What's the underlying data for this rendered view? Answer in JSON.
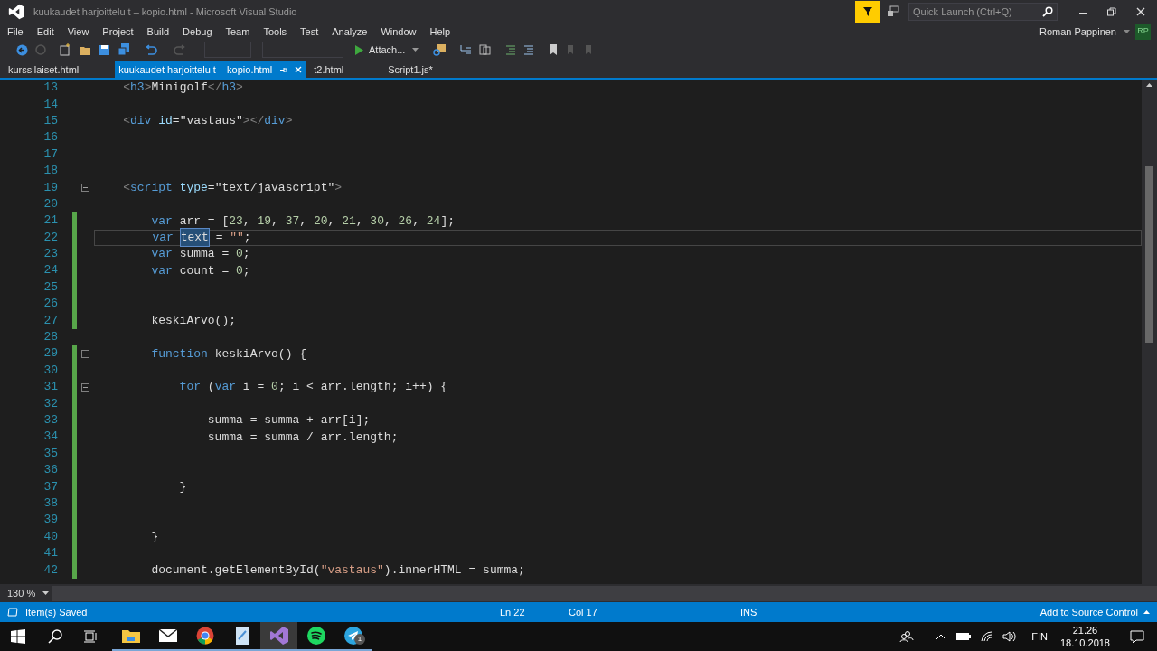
{
  "window": {
    "title": "kuukaudet harjoittelu t – kopio.html - Microsoft Visual Studio",
    "quick_launch": {
      "placeholder": "Quick Launch (Ctrl+Q)"
    },
    "user": "Roman Pappinen",
    "avatar": "RP"
  },
  "menu": [
    "File",
    "Edit",
    "View",
    "Project",
    "Build",
    "Debug",
    "Team",
    "Tools",
    "Test",
    "Analyze",
    "Window",
    "Help"
  ],
  "toolbar": {
    "attach": "Attach..."
  },
  "tabs": [
    {
      "label": "kurssilaiset.html",
      "selected": false
    },
    {
      "label": "kuukaudet harjoittelu t – kopio.html",
      "selected": true
    },
    {
      "label": "t2.html",
      "selected": false
    },
    {
      "label": "Script1.js*",
      "selected": false
    }
  ],
  "editor": {
    "lines": [
      {
        "n": "13",
        "modified": false,
        "fold": false,
        "current": false,
        "tokens": [
          {
            "t": "    <",
            "kind": "punct"
          },
          {
            "t": "h3",
            "kind": "tag"
          },
          {
            "t": ">",
            "kind": "punct"
          },
          {
            "t": "Minigolf",
            "kind": "plain"
          },
          {
            "t": "</",
            "kind": "punct"
          },
          {
            "t": "h3",
            "kind": "tag"
          },
          {
            "t": ">",
            "kind": "punct"
          }
        ]
      },
      {
        "n": "14",
        "modified": false,
        "fold": false,
        "current": false
      },
      {
        "n": "15",
        "modified": false,
        "fold": false,
        "current": false,
        "tokens": [
          {
            "t": "    <",
            "kind": "punct"
          },
          {
            "t": "div",
            "kind": "tag"
          },
          {
            "t": " id",
            "kind": "attr"
          },
          {
            "t": "=\"vastaus\"",
            "kind": "plain"
          },
          {
            "t": "></",
            "kind": "punct"
          },
          {
            "t": "div",
            "kind": "tag"
          },
          {
            "t": ">",
            "kind": "punct"
          }
        ]
      },
      {
        "n": "16",
        "modified": false,
        "fold": false,
        "current": false
      },
      {
        "n": "17",
        "modified": false,
        "fold": false,
        "current": false
      },
      {
        "n": "18",
        "modified": false,
        "fold": false,
        "current": false
      },
      {
        "n": "19",
        "modified": false,
        "fold": true,
        "current": false,
        "tokens": [
          {
            "t": "    <",
            "kind": "punct"
          },
          {
            "t": "script",
            "kind": "tag"
          },
          {
            "t": " type",
            "kind": "attr"
          },
          {
            "t": "=\"text/javascript\"",
            "kind": "plain"
          },
          {
            "t": ">",
            "kind": "punct"
          }
        ]
      },
      {
        "n": "20",
        "modified": false,
        "fold": false,
        "current": false
      },
      {
        "n": "21",
        "modified": true,
        "fold": false,
        "current": false,
        "tokens": [
          {
            "t": "        var",
            "kind": "kw"
          },
          {
            "t": " arr = [",
            "kind": "plain"
          },
          {
            "t": "23",
            "kind": "num"
          },
          {
            "t": ", ",
            "kind": "plain"
          },
          {
            "t": "19",
            "kind": "num"
          },
          {
            "t": ", ",
            "kind": "plain"
          },
          {
            "t": "37",
            "kind": "num"
          },
          {
            "t": ", ",
            "kind": "plain"
          },
          {
            "t": "20",
            "kind": "num"
          },
          {
            "t": ", ",
            "kind": "plain"
          },
          {
            "t": "21",
            "kind": "num"
          },
          {
            "t": ", ",
            "kind": "plain"
          },
          {
            "t": "30",
            "kind": "num"
          },
          {
            "t": ", ",
            "kind": "plain"
          },
          {
            "t": "26",
            "kind": "num"
          },
          {
            "t": ", ",
            "kind": "plain"
          },
          {
            "t": "24",
            "kind": "num"
          },
          {
            "t": "];",
            "kind": "plain"
          }
        ]
      },
      {
        "n": "22",
        "modified": true,
        "fold": false,
        "current": true,
        "tokens": [
          {
            "t": "        var ",
            "kind": "kw"
          },
          {
            "t": "text",
            "kind": "sel"
          },
          {
            "t": " = ",
            "kind": "plain"
          },
          {
            "t": "\"\"",
            "kind": "str"
          },
          {
            "t": ";",
            "kind": "plain"
          }
        ]
      },
      {
        "n": "23",
        "modified": true,
        "fold": false,
        "current": false,
        "tokens": [
          {
            "t": "        var",
            "kind": "kw"
          },
          {
            "t": " summa = ",
            "kind": "plain"
          },
          {
            "t": "0",
            "kind": "num"
          },
          {
            "t": ";",
            "kind": "plain"
          }
        ]
      },
      {
        "n": "24",
        "modified": true,
        "fold": false,
        "current": false,
        "tokens": [
          {
            "t": "        var",
            "kind": "kw"
          },
          {
            "t": " count = ",
            "kind": "plain"
          },
          {
            "t": "0",
            "kind": "num"
          },
          {
            "t": ";",
            "kind": "plain"
          }
        ]
      },
      {
        "n": "25",
        "modified": true,
        "fold": false,
        "current": false
      },
      {
        "n": "26",
        "modified": true,
        "fold": false,
        "current": false
      },
      {
        "n": "27",
        "modified": true,
        "fold": false,
        "current": false,
        "tokens": [
          {
            "t": "        keskiArvo();",
            "kind": "plain"
          }
        ]
      },
      {
        "n": "28",
        "modified": false,
        "fold": false,
        "current": false
      },
      {
        "n": "29",
        "modified": true,
        "fold": true,
        "current": false,
        "tokens": [
          {
            "t": "        function",
            "kind": "kw"
          },
          {
            "t": " keskiArvo() {",
            "kind": "plain"
          }
        ]
      },
      {
        "n": "30",
        "modified": true,
        "fold": false,
        "current": false
      },
      {
        "n": "31",
        "modified": true,
        "fold": true,
        "current": false,
        "tokens": [
          {
            "t": "            for",
            "kind": "kw"
          },
          {
            "t": " (",
            "kind": "plain"
          },
          {
            "t": "var",
            "kind": "kw"
          },
          {
            "t": " i = ",
            "kind": "plain"
          },
          {
            "t": "0",
            "kind": "num"
          },
          {
            "t": "; i < arr.length; i++) {",
            "kind": "plain"
          }
        ]
      },
      {
        "n": "32",
        "modified": true,
        "fold": false,
        "current": false
      },
      {
        "n": "33",
        "modified": true,
        "fold": false,
        "current": false,
        "tokens": [
          {
            "t": "                summa = summa + arr[i];",
            "kind": "plain"
          }
        ]
      },
      {
        "n": "34",
        "modified": true,
        "fold": false,
        "current": false,
        "tokens": [
          {
            "t": "                summa = summa / arr.length;",
            "kind": "plain"
          }
        ]
      },
      {
        "n": "35",
        "modified": true,
        "fold": false,
        "current": false
      },
      {
        "n": "36",
        "modified": true,
        "fold": false,
        "current": false
      },
      {
        "n": "37",
        "modified": true,
        "fold": false,
        "current": false,
        "tokens": [
          {
            "t": "            }",
            "kind": "plain"
          }
        ]
      },
      {
        "n": "38",
        "modified": true,
        "fold": false,
        "current": false
      },
      {
        "n": "39",
        "modified": true,
        "fold": false,
        "current": false
      },
      {
        "n": "40",
        "modified": true,
        "fold": false,
        "current": false,
        "tokens": [
          {
            "t": "        }",
            "kind": "plain"
          }
        ]
      },
      {
        "n": "41",
        "modified": true,
        "fold": false,
        "current": false
      },
      {
        "n": "42",
        "modified": true,
        "fold": false,
        "current": false,
        "tokens": [
          {
            "t": "        document.getElementById(",
            "kind": "plain"
          },
          {
            "t": "\"vastaus\"",
            "kind": "str"
          },
          {
            "t": ").innerHTML = summa;",
            "kind": "plain"
          }
        ]
      }
    ],
    "zoom": "130 %"
  },
  "status_bar": {
    "message": "Item(s) Saved",
    "line": "Ln 22",
    "column": "Col 17",
    "mode": "INS",
    "source_control": "Add to Source Control"
  },
  "taskbar": {
    "apps": [
      {
        "kind": "explorer",
        "selected": false
      },
      {
        "kind": "mail",
        "selected": false
      },
      {
        "kind": "chrome",
        "selected": false
      },
      {
        "kind": "document",
        "selected": false
      },
      {
        "kind": "studio",
        "selected": true
      },
      {
        "kind": "spotify",
        "selected": false
      },
      {
        "kind": "telegram",
        "selected": false,
        "badge": "1"
      }
    ],
    "language": "FIN",
    "time": "21.26",
    "date": "18.10.2018"
  }
}
